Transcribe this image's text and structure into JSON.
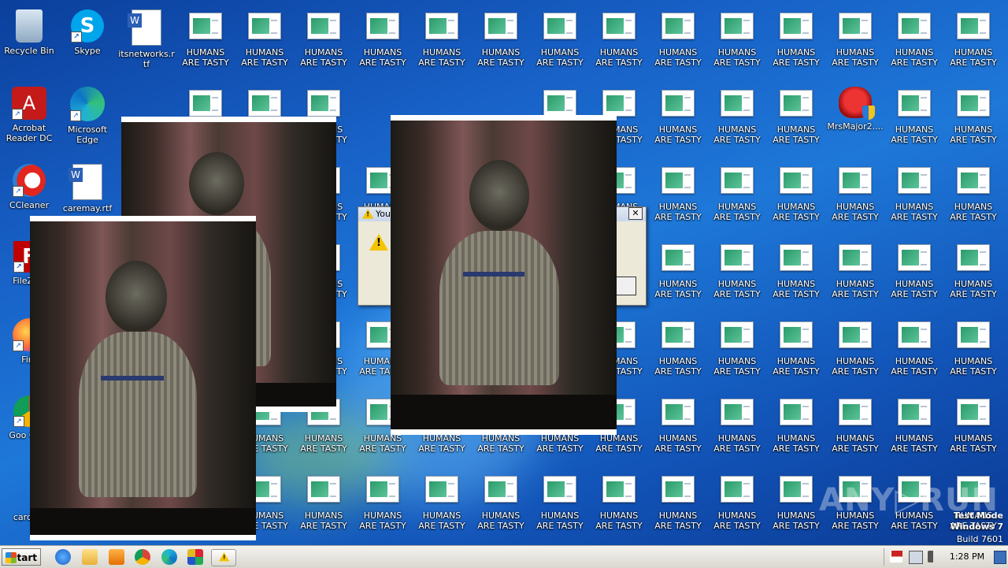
{
  "desktop_icons": {
    "recycle_bin": "Recycle Bin",
    "skype": "Skype",
    "itsnetworks": "itsnetworks.rtf",
    "acrobat": "Acrobat Reader DC",
    "edge": "Microsoft Edge",
    "ccleaner": "CCleaner",
    "caremay": "caremay.rtf",
    "filezilla": "FileZilla",
    "firefox": "Fire",
    "chrome": "Goo Chro",
    "cardlist": "cardlist",
    "mrsmajor": "MrsMajor2...."
  },
  "hta_label": "HUMANS ARE TASTY HUM...",
  "dialog": {
    "title": "You",
    "close": "✕",
    "button": "e"
  },
  "taskbar": {
    "start_label": "Start",
    "clock": "1:28 PM"
  },
  "os_watermark": {
    "line1": "Test Mode",
    "line2": "Windows 7",
    "line3": "Build 7601"
  },
  "anyrun": "ANY▷RUN",
  "colors": {
    "desktop": "#1862c8",
    "warning": "#f4c400"
  }
}
